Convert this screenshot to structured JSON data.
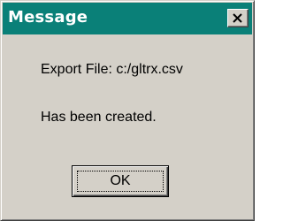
{
  "window": {
    "title": "Message",
    "close_icon": "close-x-icon",
    "title_bar_color": "#0a8078",
    "body_color": "#d4d0c8"
  },
  "message": {
    "line1": "Export File:   c:/gltrx.csv",
    "line2": "Has been created."
  },
  "buttons": {
    "ok_label": "OK"
  }
}
